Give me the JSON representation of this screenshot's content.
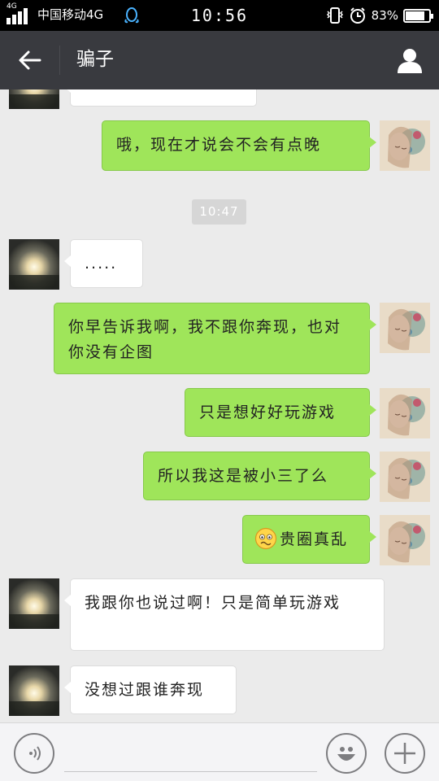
{
  "status_bar": {
    "network": "4G",
    "carrier": "中国移动4G",
    "time": "10:56",
    "battery_percent": "83%",
    "battery_level": 0.83
  },
  "nav": {
    "title": "骗子"
  },
  "messages": [
    {
      "side": "out",
      "text": "哦，现在才说会不会有点晚"
    },
    {
      "type": "timestamp",
      "text": "10:47"
    },
    {
      "side": "in",
      "text": "....."
    },
    {
      "side": "out",
      "text": "你早告诉我啊，我不跟你奔现，也对你没有企图"
    },
    {
      "side": "out",
      "text": "只是想好好玩游戏"
    },
    {
      "side": "out",
      "text": "所以我这是被小三了么"
    },
    {
      "side": "out",
      "emoji": "confused-face",
      "text": "贵圈真乱"
    },
    {
      "side": "in",
      "text": "我跟你也说过啊！只是简单玩游戏"
    },
    {
      "side": "in",
      "text": "没想过跟谁奔现"
    }
  ],
  "input": {
    "placeholder": ""
  },
  "colors": {
    "status_bar": "#000000",
    "nav_bar": "#393a3f",
    "chat_bg": "#ebebeb",
    "outgoing_bubble": "#9fe55a",
    "incoming_bubble": "#ffffff"
  },
  "icons": {
    "back": "arrow-left-icon",
    "profile": "person-icon",
    "voice": "voice-icon",
    "emoji": "smiley-icon",
    "plus": "plus-icon"
  }
}
